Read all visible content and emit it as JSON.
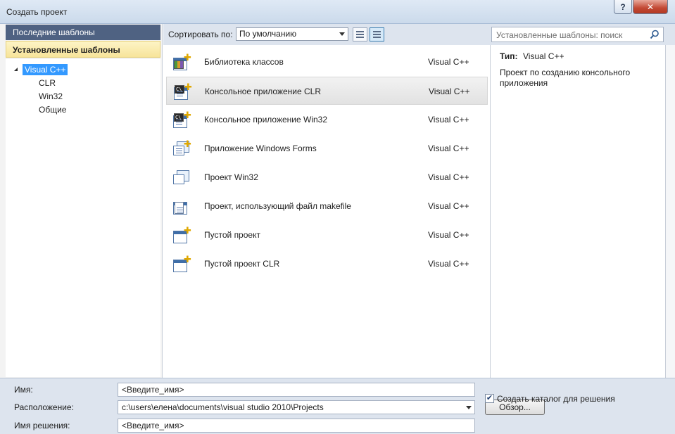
{
  "window": {
    "title": "Создать проект",
    "help_label": "?",
    "close_label": "✕"
  },
  "sidebar": {
    "recent_label": "Последние шаблоны",
    "installed_label": "Установленные шаблоны",
    "tree": {
      "root": "Visual C++",
      "children": [
        "CLR",
        "Win32",
        "Общие"
      ]
    }
  },
  "toolbar": {
    "sort_label": "Сортировать по:",
    "sort_value": "По умолчанию"
  },
  "search": {
    "placeholder": "Установленные шаблоны: поиск"
  },
  "templates": [
    {
      "name": "Библиотека классов",
      "lang": "Visual C++",
      "icon": "class-library-icon"
    },
    {
      "name": "Консольное приложение CLR",
      "lang": "Visual C++",
      "icon": "console-app-icon",
      "selected": true
    },
    {
      "name": "Консольное приложение Win32",
      "lang": "Visual C++",
      "icon": "console-app-icon"
    },
    {
      "name": "Приложение Windows Forms",
      "lang": "Visual C++",
      "icon": "windows-forms-icon"
    },
    {
      "name": "Проект Win32",
      "lang": "Visual C++",
      "icon": "win32-project-icon"
    },
    {
      "name": "Проект, использующий файл makefile",
      "lang": "Visual C++",
      "icon": "makefile-project-icon"
    },
    {
      "name": "Пустой проект",
      "lang": "Visual C++",
      "icon": "empty-project-icon"
    },
    {
      "name": "Пустой проект CLR",
      "lang": "Visual C++",
      "icon": "empty-project-icon"
    }
  ],
  "details": {
    "type_label": "Тип:",
    "type_value": "Visual C++",
    "description": "Проект по созданию консольного приложения"
  },
  "form": {
    "name_label": "Имя:",
    "name_value": "<Введите_имя>",
    "location_label": "Расположение:",
    "location_value": "c:\\users\\елена\\documents\\visual studio 2010\\Projects",
    "solution_label": "Имя решения:",
    "solution_value": "<Введите_имя>",
    "browse_label": "Обзор...",
    "create_dir_label": "Создать каталог для решения",
    "create_dir_checked": true
  }
}
